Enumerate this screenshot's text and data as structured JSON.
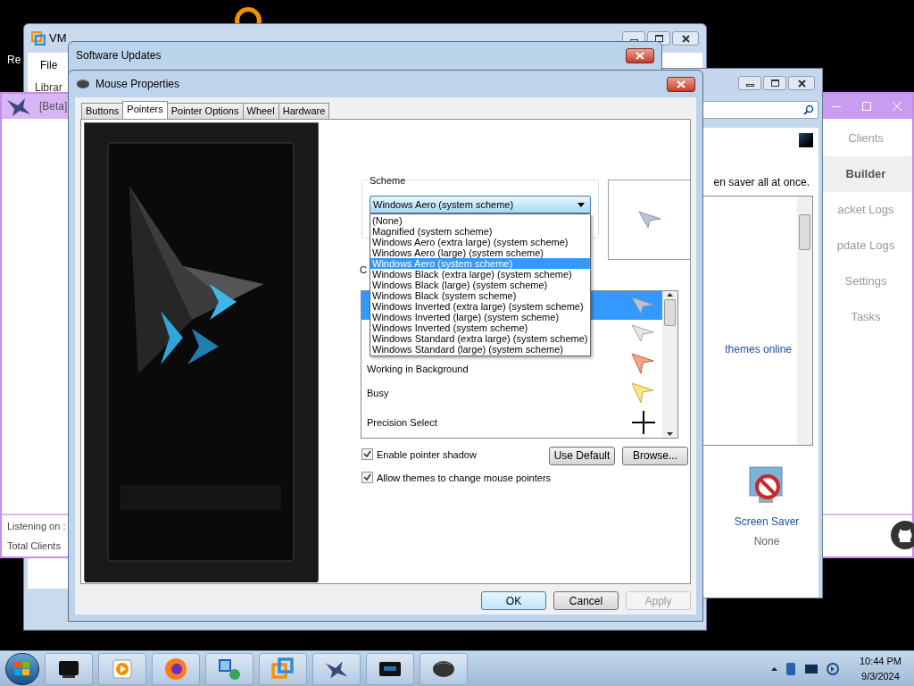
{
  "desktop": {
    "partial_label": "Re"
  },
  "vmware": {
    "title": "VM",
    "menu": [
      "File"
    ],
    "partial_label": "Librar"
  },
  "rat_app": {
    "title": "[Beta]",
    "nav": [
      {
        "label": "Clients",
        "selected": false
      },
      {
        "label": "Builder",
        "selected": true
      },
      {
        "label": "acket Logs",
        "selected": false
      },
      {
        "label": "pdate Logs",
        "selected": false
      },
      {
        "label": "Settings",
        "selected": false
      },
      {
        "label": "Tasks",
        "selected": false
      }
    ],
    "status": [
      "Listening on :",
      "Total Clients"
    ]
  },
  "personalization": {
    "description": "en saver all at once.",
    "link": "themes online",
    "screen_saver": {
      "label": "Screen Saver",
      "value": "None"
    }
  },
  "software_updates": {
    "title": "Software Updates"
  },
  "mouse_properties": {
    "title": "Mouse Properties",
    "tabs": [
      {
        "label": "Buttons",
        "selected": false
      },
      {
        "label": "Pointers",
        "selected": true
      },
      {
        "label": "Pointer Options",
        "selected": false
      },
      {
        "label": "Wheel",
        "selected": false
      },
      {
        "label": "Hardware",
        "selected": false
      }
    ],
    "scheme": {
      "label": "Scheme",
      "value": "Windows Aero (system scheme)",
      "options": [
        {
          "label": "(None)",
          "selected": false
        },
        {
          "label": "Magnified (system scheme)",
          "selected": false
        },
        {
          "label": "Windows Aero (extra large) (system scheme)",
          "selected": false
        },
        {
          "label": "Windows Aero (large) (system scheme)",
          "selected": false
        },
        {
          "label": "Windows Aero (system scheme)",
          "selected": true
        },
        {
          "label": "Windows Black (extra large) (system scheme)",
          "selected": false
        },
        {
          "label": "Windows Black (large) (system scheme)",
          "selected": false
        },
        {
          "label": "Windows Black (system scheme)",
          "selected": false
        },
        {
          "label": "Windows Inverted (extra large) (system scheme)",
          "selected": false
        },
        {
          "label": "Windows Inverted (large) (system scheme)",
          "selected": false
        },
        {
          "label": "Windows Inverted (system scheme)",
          "selected": false
        },
        {
          "label": "Windows Standard (extra large) (system scheme)",
          "selected": false
        },
        {
          "label": "Windows Standard (large) (system scheme)",
          "selected": false
        }
      ]
    },
    "customize_label": "C",
    "pointers": [
      {
        "kind": "arrow",
        "selected": true
      },
      {
        "kind": "help",
        "selected": false
      },
      {
        "kind": "working",
        "label": "Working in Background",
        "selected": false
      },
      {
        "kind": "busy",
        "label": "Busy",
        "selected": false
      },
      {
        "kind": "cross",
        "label": "Precision Select",
        "selected": false
      }
    ],
    "checkboxes": [
      {
        "label": "Enable pointer shadow",
        "checked": true
      },
      {
        "label": "Allow themes to change mouse pointers",
        "checked": true
      }
    ],
    "side_buttons": [
      {
        "label": "Use Default",
        "disabled": false
      },
      {
        "label": "Browse...",
        "disabled": false
      }
    ],
    "footer_buttons": [
      {
        "label": "OK",
        "disabled": false,
        "default": true
      },
      {
        "label": "Cancel",
        "disabled": false,
        "default": false
      },
      {
        "label": "Apply",
        "disabled": true,
        "default": false
      }
    ]
  },
  "taskbar": {
    "time": "10:44 PM",
    "date": "9/3/2024"
  }
}
